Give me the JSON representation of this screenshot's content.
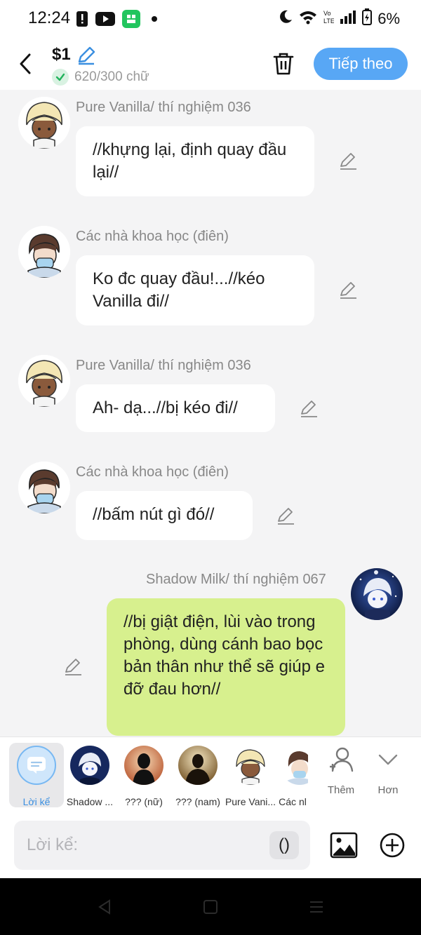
{
  "status_bar": {
    "time": "12:24",
    "battery": "6%"
  },
  "header": {
    "title": "$1",
    "word_count": "620/300 chữ",
    "next_label": "Tiếp theo"
  },
  "messages": [
    {
      "sender": "Pure Vanilla/ thí nghiệm 036",
      "text": "//khựng lại, định quay đầu lại//"
    },
    {
      "sender": "Các nhà khoa học (điên)",
      "text": "Ko đc quay đầu!...//kéo Vanilla đi//"
    },
    {
      "sender": "Pure Vanilla/ thí nghiệm 036",
      "text": "Ah- dạ...//bị kéo đi//"
    },
    {
      "sender": "Các nhà khoa học (điên)",
      "text": "//bấm nút gì đó//"
    },
    {
      "sender": "Shadow Milk/ thí nghiệm 067",
      "text": "//bị giật điện, lùi vào trong phòng, dùng cánh bao bọc bản thân như thể sẽ giúp e đỡ đau hơn//"
    }
  ],
  "character_bar": {
    "items": [
      {
        "label": "Lời kể"
      },
      {
        "label": "Shadow ..."
      },
      {
        "label": "??? (nữ)"
      },
      {
        "label": "??? (nam)"
      },
      {
        "label": "Pure Vani..."
      },
      {
        "label": "Các nl"
      }
    ],
    "add_label": "Thêm",
    "more_label": "Hơn"
  },
  "input": {
    "placeholder": "Lời kể:",
    "paren_label": "()"
  },
  "colors": {
    "accent": "#58a7f5",
    "bubble_self": "#d7f08e",
    "background": "#f4f4f5"
  }
}
